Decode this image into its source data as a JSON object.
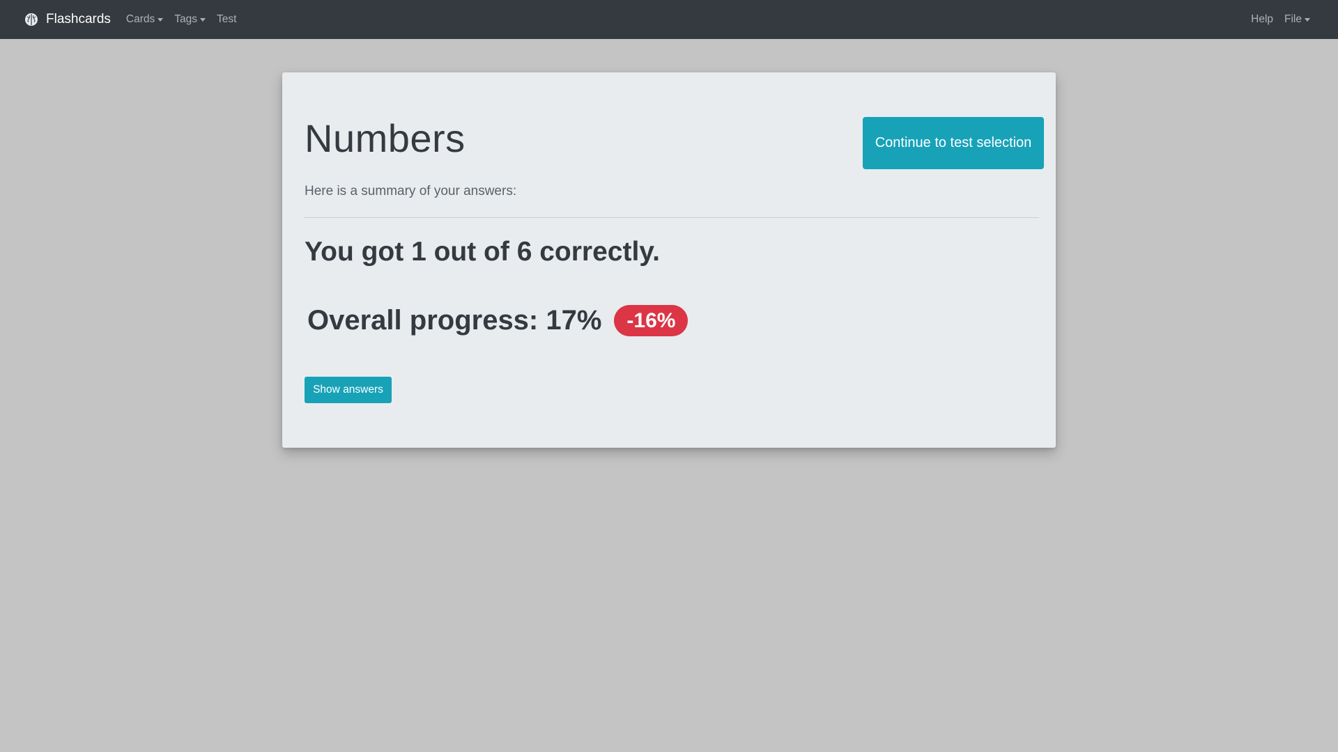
{
  "navbar": {
    "brand": "Flashcards",
    "brand_icon": "brain-icon",
    "left_items": [
      {
        "label": "Cards",
        "dropdown": true
      },
      {
        "label": "Tags",
        "dropdown": true
      },
      {
        "label": "Test",
        "dropdown": false
      }
    ],
    "right_items": [
      {
        "label": "Help",
        "dropdown": false
      },
      {
        "label": "File",
        "dropdown": true
      }
    ]
  },
  "main": {
    "title": "Numbers",
    "continue_label": "Continue to test selection",
    "summary_text": "Here is a summary of your answers:",
    "score_text": "You got 1 out of 6 correctly.",
    "progress_text": "Overall progress: 17%",
    "progress_change": "-16%",
    "show_answers_label": "Show answers"
  },
  "colors": {
    "navbar_bg": "#343a40",
    "accent": "#17a2b8",
    "danger": "#dc3545",
    "card_bg": "#e8ecef",
    "page_bg": "#c4c4c4"
  }
}
